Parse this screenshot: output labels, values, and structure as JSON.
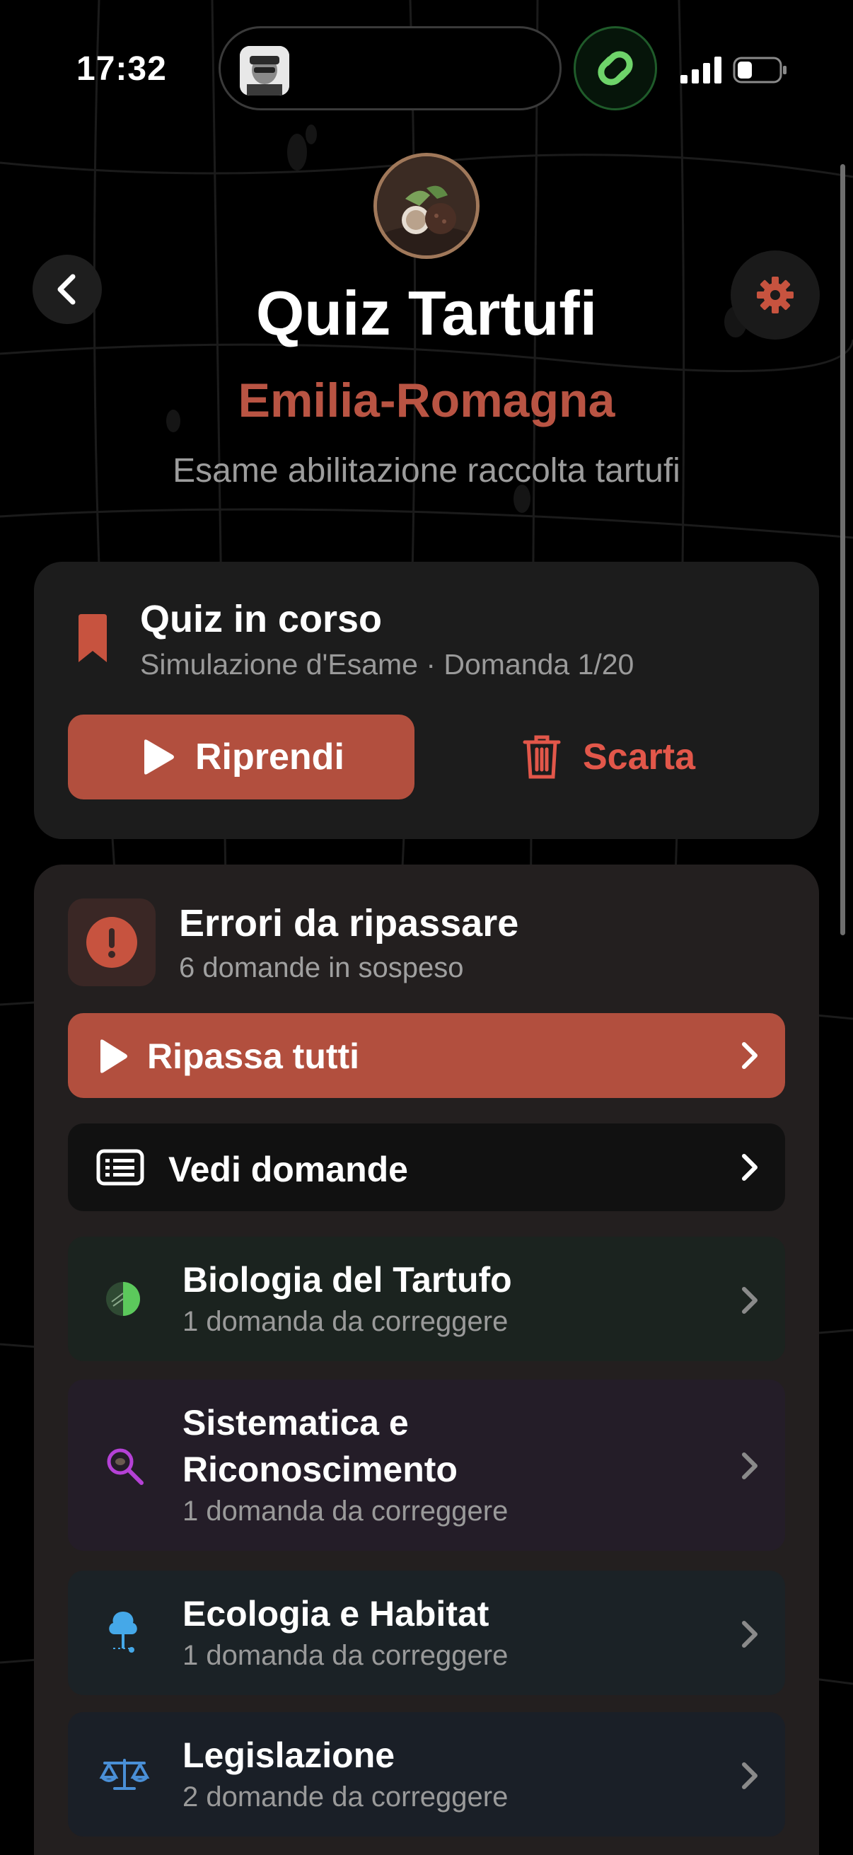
{
  "status_bar": {
    "time": "17:32"
  },
  "header": {
    "title": "Quiz Tartufi",
    "region": "Emilia-Romagna",
    "subtitle": "Esame abilitazione raccolta tartufi"
  },
  "quiz_in_progress": {
    "title": "Quiz in corso",
    "subtitle": "Simulazione d'Esame · Domanda 1/20",
    "resume_label": "Riprendi",
    "discard_label": "Scarta"
  },
  "errors": {
    "title": "Errori da ripassare",
    "subtitle": "6 domande in sospeso",
    "review_all_label": "Ripassa tutti",
    "see_questions_label": "Vedi domande",
    "categories": [
      {
        "name": "Biologia del Tartufo",
        "count": "1 domanda da correggere",
        "icon": "pie-chart-icon",
        "color": "#5cc95c"
      },
      {
        "name": "Sistematica e Riconoscimento",
        "count": "1 domanda da correggere",
        "icon": "magnifier-icon",
        "color": "#b541d6"
      },
      {
        "name": "Ecologia e Habitat",
        "count": "1 domanda da correggere",
        "icon": "tree-icon",
        "color": "#45a8e8"
      },
      {
        "name": "Legislazione",
        "count": "2 domande da correggere",
        "icon": "scales-icon",
        "color": "#4a8fd6"
      }
    ]
  },
  "colors": {
    "accent": "#b24f3e",
    "region_text": "#b95443",
    "discard": "#e2574a",
    "background": "#000000"
  }
}
